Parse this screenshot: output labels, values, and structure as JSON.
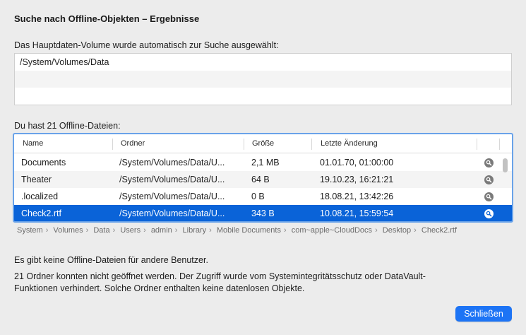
{
  "dialog": {
    "title": "Suche nach Offline-Objekten – Ergebnisse",
    "volume_label": "Das Hauptdaten-Volume wurde automatisch zur Suche ausgewählt:",
    "volumes": [
      "/System/Volumes/Data"
    ],
    "files_label": "Du hast 21 Offline-Dateien:",
    "columns": {
      "name": "Name",
      "folder": "Ordner",
      "size": "Größe",
      "modified": "Letzte Änderung"
    },
    "rows": [
      {
        "name": "Documents",
        "folder": "/System/Volumes/Data/U...",
        "size": "2,1 MB",
        "modified": "01.01.70, 01:00:00",
        "selected": false
      },
      {
        "name": "Theater",
        "folder": "/System/Volumes/Data/U...",
        "size": "64  B",
        "modified": "19.10.23, 16:21:21",
        "selected": false
      },
      {
        "name": ".localized",
        "folder": "/System/Volumes/Data/U...",
        "size": "0  B",
        "modified": "18.08.21, 13:42:26",
        "selected": false
      },
      {
        "name": "Check2.rtf",
        "folder": "/System/Volumes/Data/U...",
        "size": "343  B",
        "modified": "10.08.21, 15:59:54",
        "selected": true
      }
    ],
    "path": [
      "System",
      "Volumes",
      "Data",
      "Users",
      "admin",
      "Library",
      "Mobile Documents",
      "com~apple~CloudDocs",
      "Desktop",
      "Check2.rtf"
    ],
    "path_separator": "›",
    "no_other_users": "Es gibt keine Offline-Dateien für andere Benutzer.",
    "folders_msg_line1": "21 Ordner konnten nicht geöffnet werden. Der Zugriff wurde vom Systemintegritätsschutz oder DataVault-",
    "folders_msg_line2": "Funktionen verhindert. Solche Ordner enthalten keine datenlosen Objekte.",
    "close_label": "Schließen",
    "icons": {
      "reveal": "magnifier-reveal-icon"
    },
    "colors": {
      "accent": "#1d74f5",
      "selection": "#0a63d8",
      "focus_ring": "#6aa3e9"
    }
  }
}
